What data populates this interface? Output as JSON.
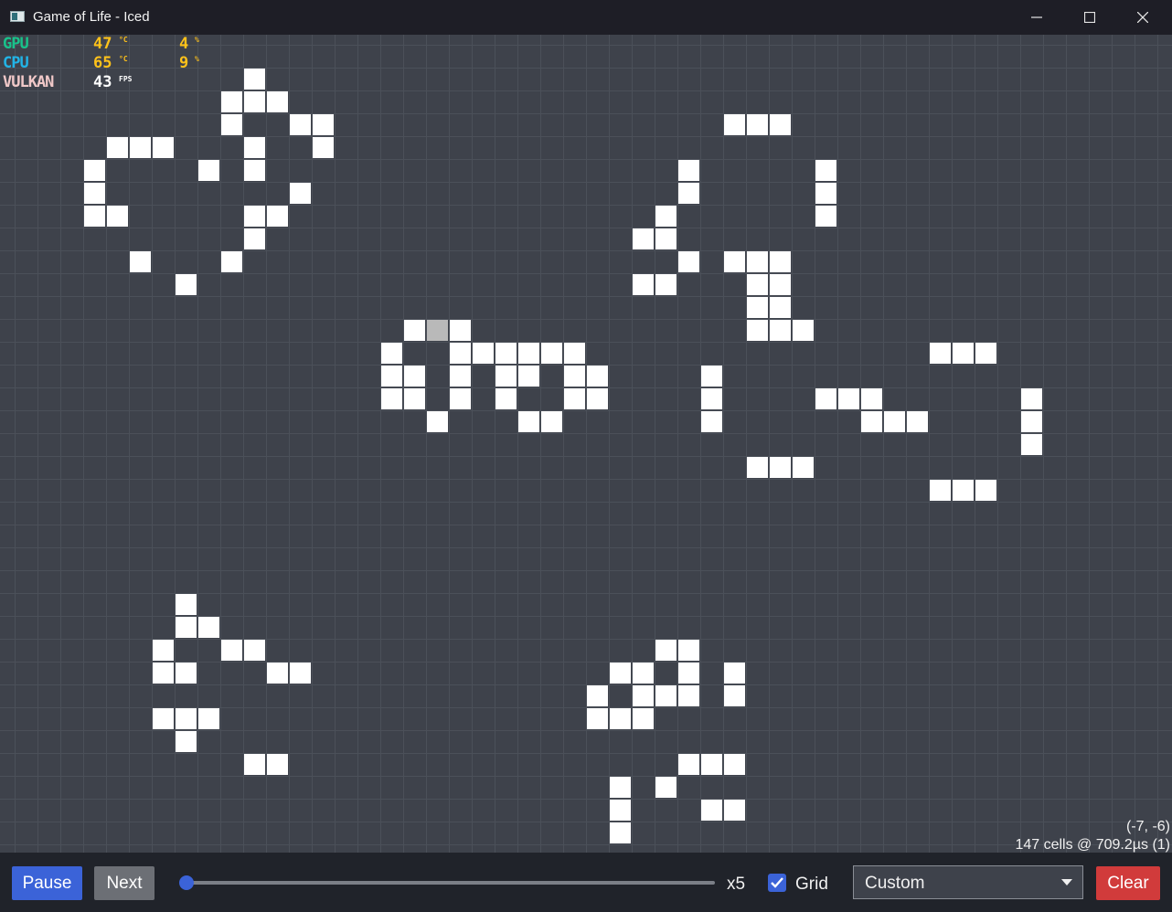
{
  "window": {
    "title": "Game of Life - Iced",
    "minimize_icon": "minimize-icon",
    "maximize_icon": "maximize-icon",
    "close_icon": "close-icon"
  },
  "perf_overlay": {
    "rows": [
      {
        "label": "GPU",
        "value": "47",
        "unit": "°C",
        "value2": "4",
        "unit2": "%",
        "color": "#19c28b"
      },
      {
        "label": "CPU",
        "value": "65",
        "unit": "°C",
        "value2": "9",
        "unit2": "%",
        "color": "#22b4e6"
      },
      {
        "label": "VULKAN",
        "value": "43",
        "unit": "FPS",
        "color": "#f0c8c8"
      }
    ]
  },
  "canvas": {
    "cursor_coords": "(-7, -6)",
    "stats": "147 cells @ 709.2µs (1)",
    "hover_cell": [
      18,
      12
    ],
    "cells": [
      [
        10,
        1
      ],
      [
        9,
        2
      ],
      [
        10,
        2
      ],
      [
        11,
        2
      ],
      [
        9,
        3
      ],
      [
        12,
        3
      ],
      [
        13,
        3
      ],
      [
        4,
        4
      ],
      [
        5,
        4
      ],
      [
        6,
        4
      ],
      [
        10,
        4
      ],
      [
        13,
        4
      ],
      [
        3,
        5
      ],
      [
        8,
        5
      ],
      [
        10,
        5
      ],
      [
        3,
        6
      ],
      [
        12,
        6
      ],
      [
        3,
        7
      ],
      [
        4,
        7
      ],
      [
        10,
        7
      ],
      [
        11,
        7
      ],
      [
        10,
        8
      ],
      [
        5,
        9
      ],
      [
        9,
        9
      ],
      [
        7,
        10
      ],
      [
        31,
        3
      ],
      [
        32,
        3
      ],
      [
        33,
        3
      ],
      [
        29,
        5
      ],
      [
        35,
        5
      ],
      [
        29,
        6
      ],
      [
        35,
        6
      ],
      [
        28,
        7
      ],
      [
        35,
        7
      ],
      [
        27,
        8
      ],
      [
        28,
        8
      ],
      [
        29,
        9
      ],
      [
        31,
        9
      ],
      [
        32,
        9
      ],
      [
        33,
        9
      ],
      [
        27,
        10
      ],
      [
        28,
        10
      ],
      [
        32,
        10
      ],
      [
        33,
        10
      ],
      [
        32,
        11
      ],
      [
        33,
        11
      ],
      [
        32,
        12
      ],
      [
        33,
        12
      ],
      [
        34,
        12
      ],
      [
        17,
        12
      ],
      [
        19,
        12
      ],
      [
        16,
        13
      ],
      [
        19,
        13
      ],
      [
        20,
        13
      ],
      [
        21,
        13
      ],
      [
        22,
        13
      ],
      [
        23,
        13
      ],
      [
        24,
        13
      ],
      [
        16,
        14
      ],
      [
        17,
        14
      ],
      [
        19,
        14
      ],
      [
        21,
        14
      ],
      [
        22,
        14
      ],
      [
        24,
        14
      ],
      [
        25,
        14
      ],
      [
        16,
        15
      ],
      [
        17,
        15
      ],
      [
        19,
        15
      ],
      [
        21,
        15
      ],
      [
        24,
        15
      ],
      [
        25,
        15
      ],
      [
        18,
        16
      ],
      [
        22,
        16
      ],
      [
        23,
        16
      ],
      [
        40,
        13
      ],
      [
        41,
        13
      ],
      [
        42,
        13
      ],
      [
        30,
        14
      ],
      [
        30,
        15
      ],
      [
        35,
        15
      ],
      [
        36,
        15
      ],
      [
        37,
        15
      ],
      [
        44,
        15
      ],
      [
        30,
        16
      ],
      [
        37,
        16
      ],
      [
        38,
        16
      ],
      [
        39,
        16
      ],
      [
        44,
        16
      ],
      [
        44,
        17
      ],
      [
        32,
        18
      ],
      [
        33,
        18
      ],
      [
        34,
        18
      ],
      [
        40,
        19
      ],
      [
        41,
        19
      ],
      [
        42,
        19
      ],
      [
        7,
        24
      ],
      [
        7,
        25
      ],
      [
        8,
        25
      ],
      [
        6,
        26
      ],
      [
        9,
        26
      ],
      [
        10,
        26
      ],
      [
        6,
        27
      ],
      [
        7,
        27
      ],
      [
        11,
        27
      ],
      [
        12,
        27
      ],
      [
        6,
        29
      ],
      [
        7,
        29
      ],
      [
        8,
        29
      ],
      [
        7,
        30
      ],
      [
        10,
        31
      ],
      [
        11,
        31
      ],
      [
        28,
        26
      ],
      [
        29,
        26
      ],
      [
        26,
        27
      ],
      [
        27,
        27
      ],
      [
        29,
        27
      ],
      [
        31,
        27
      ],
      [
        25,
        28
      ],
      [
        27,
        28
      ],
      [
        28,
        28
      ],
      [
        29,
        28
      ],
      [
        31,
        28
      ],
      [
        25,
        29
      ],
      [
        26,
        29
      ],
      [
        27,
        29
      ],
      [
        29,
        31
      ],
      [
        30,
        31
      ],
      [
        31,
        31
      ],
      [
        26,
        32
      ],
      [
        28,
        32
      ],
      [
        26,
        33
      ],
      [
        30,
        33
      ],
      [
        31,
        33
      ],
      [
        26,
        34
      ]
    ]
  },
  "controls": {
    "pause_label": "Pause",
    "next_label": "Next",
    "speed_label": "x5",
    "speed_value": 0,
    "grid_checked": true,
    "grid_label": "Grid",
    "preset_value": "Custom",
    "clear_label": "Clear",
    "accent_color": "#3b63d8",
    "clear_color": "#d13b3b"
  }
}
